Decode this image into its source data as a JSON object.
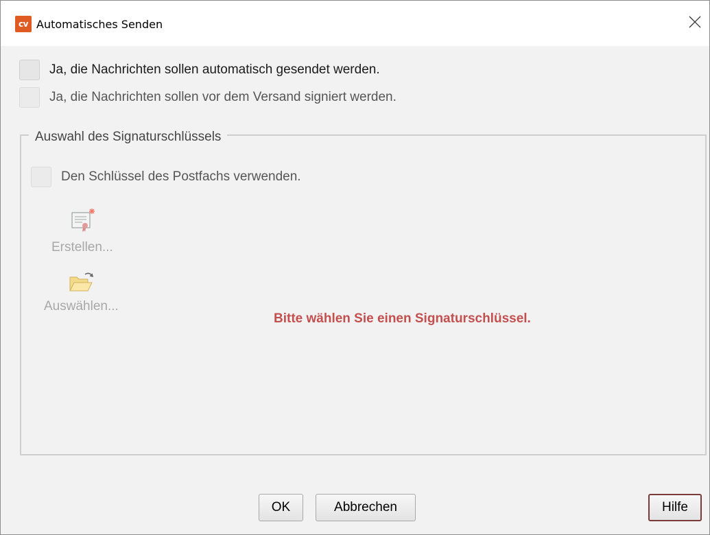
{
  "window": {
    "title": "Automatisches Senden",
    "logo_text": "cv",
    "accent_color": "#e05a23"
  },
  "options": {
    "auto_send": {
      "label": "Ja, die Nachrichten sollen automatisch gesendet werden.",
      "checked": false,
      "enabled": true
    },
    "sign_before_send": {
      "label": "Ja, die Nachrichten sollen vor dem Versand signiert werden.",
      "checked": false,
      "enabled": false
    }
  },
  "signature_group": {
    "title": "Auswahl des Signaturschlüssels",
    "use_mailbox_key": {
      "label": "Den Schlüssel des Postfachs verwenden.",
      "checked": false,
      "enabled": false
    },
    "create_button": {
      "label": "Erstellen...",
      "icon": "certificate-new-icon",
      "enabled": false
    },
    "select_button": {
      "label": "Auswählen...",
      "icon": "folder-open-icon",
      "enabled": false
    },
    "message": "Bitte wählen Sie einen Signaturschlüssel.",
    "message_color": "#c34f4f"
  },
  "footer": {
    "ok_label": "OK",
    "cancel_label": "Abbrechen",
    "help_label": "Hilfe"
  }
}
